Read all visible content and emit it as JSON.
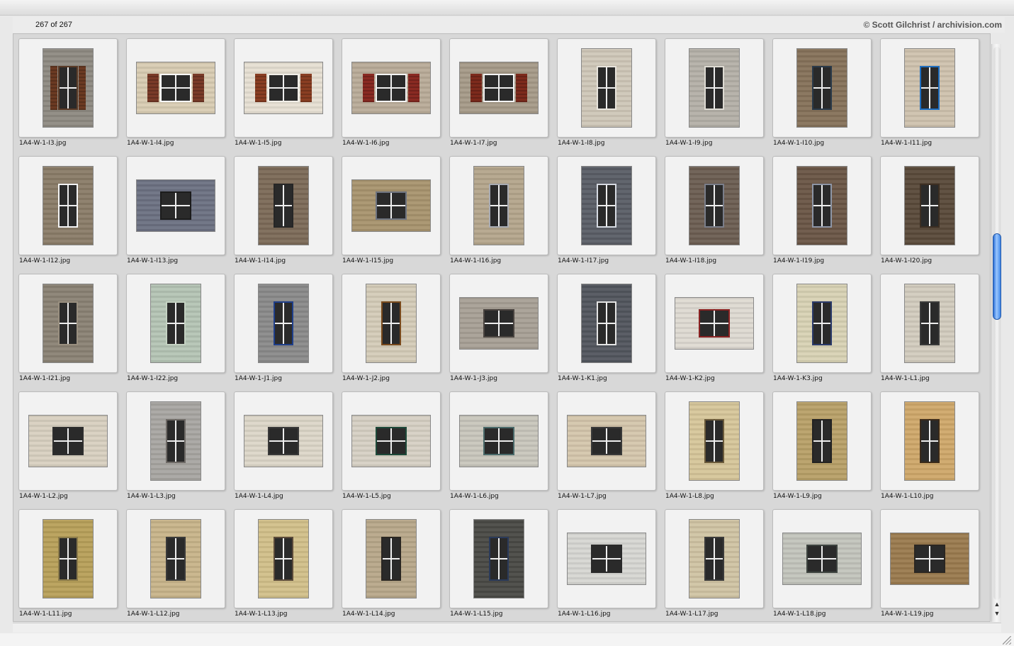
{
  "header": {
    "count": "267 of 267",
    "copyright": "© Scott Gilchrist / archivision.com"
  },
  "scrollbar": {
    "up_glyph": "▲",
    "down_glyph": "▼",
    "position": 0.4
  },
  "thumbnails": [
    {
      "label": "1A4-W-1-I3.jpg",
      "orient": "sq",
      "bg": "#8e8a82",
      "frame": "#5a3a26",
      "shutter": "#6b3a22"
    },
    {
      "label": "1A4-W-1-I4.jpg",
      "orient": "land",
      "bg": "#d8ccb2",
      "frame": "#ffffff",
      "shutter": "#7a3b28"
    },
    {
      "label": "1A4-W-1-I5.jpg",
      "orient": "land",
      "bg": "#e6dfd2",
      "frame": "#f2efe8",
      "shutter": "#8a3e22"
    },
    {
      "label": "1A4-W-1-I6.jpg",
      "orient": "land",
      "bg": "#b9ab98",
      "frame": "#f4f4f4",
      "shutter": "#8a2a22"
    },
    {
      "label": "1A4-W-1-I7.jpg",
      "orient": "land",
      "bg": "#a69a88",
      "frame": "#f4f4f4",
      "shutter": "#7d2a1c"
    },
    {
      "label": "1A4-W-1-I8.jpg",
      "orient": "port",
      "bg": "#cfc7b8",
      "frame": "#e8e4dc",
      "shutter": ""
    },
    {
      "label": "1A4-W-1-I9.jpg",
      "orient": "port",
      "bg": "#b4b0a8",
      "frame": "#dddad2",
      "shutter": ""
    },
    {
      "label": "1A4-W-1-I10.jpg",
      "orient": "port",
      "bg": "#86725a",
      "frame": "#2a3a4a",
      "shutter": ""
    },
    {
      "label": "1A4-W-1-I11.jpg",
      "orient": "port",
      "bg": "#cfc2ae",
      "frame": "#1e6ec0",
      "shutter": ""
    },
    {
      "label": "1A4-W-1-I12.jpg",
      "orient": "sq",
      "bg": "#8a7c68",
      "frame": "#f4f4f4",
      "shutter": ""
    },
    {
      "label": "1A4-W-1-I13.jpg",
      "orient": "land",
      "bg": "#6c7182",
      "frame": "#1c1c1c",
      "shutter": ""
    },
    {
      "label": "1A4-W-1-I14.jpg",
      "orient": "port",
      "bg": "#7c6a58",
      "frame": "#262626",
      "shutter": ""
    },
    {
      "label": "1A4-W-1-I15.jpg",
      "orient": "land",
      "bg": "#a8946e",
      "frame": "#6e7480",
      "shutter": ""
    },
    {
      "label": "1A4-W-1-I16.jpg",
      "orient": "port",
      "bg": "#b4a68c",
      "frame": "#a9acb4",
      "shutter": ""
    },
    {
      "label": "1A4-W-1-I17.jpg",
      "orient": "port",
      "bg": "#5a5e66",
      "frame": "#d6dae2",
      "shutter": ""
    },
    {
      "label": "1A4-W-1-I18.jpg",
      "orient": "port",
      "bg": "#6c5e52",
      "frame": "#7a7e8a",
      "shutter": ""
    },
    {
      "label": "1A4-W-1-I19.jpg",
      "orient": "port",
      "bg": "#6a5646",
      "frame": "#8e96a6",
      "shutter": ""
    },
    {
      "label": "1A4-W-1-I20.jpg",
      "orient": "port",
      "bg": "#5a4a3a",
      "frame": "#3c2e22",
      "shutter": ""
    },
    {
      "label": "1A4-W-1-I21.jpg",
      "orient": "sq",
      "bg": "#8a8274",
      "frame": "#9a9080",
      "shutter": ""
    },
    {
      "label": "1A4-W-1-I22.jpg",
      "orient": "port",
      "bg": "#b4c4b4",
      "frame": "#c4d2c2",
      "shutter": ""
    },
    {
      "label": "1A4-W-1-J1.jpg",
      "orient": "port",
      "bg": "#8a8a8a",
      "frame": "#1e3e8a",
      "shutter": ""
    },
    {
      "label": "1A4-W-1-J2.jpg",
      "orient": "port",
      "bg": "#d4ccb8",
      "frame": "#7a4a1c",
      "shutter": ""
    },
    {
      "label": "1A4-W-1-J3.jpg",
      "orient": "land",
      "bg": "#a8a096",
      "frame": "#4a4440",
      "shutter": ""
    },
    {
      "label": "1A4-W-1-K1.jpg",
      "orient": "port",
      "bg": "#52565e",
      "frame": "#e4e4e4",
      "shutter": ""
    },
    {
      "label": "1A4-W-1-K2.jpg",
      "orient": "land",
      "bg": "#dedad2",
      "frame": "#8a2222",
      "shutter": ""
    },
    {
      "label": "1A4-W-1-K3.jpg",
      "orient": "port",
      "bg": "#d8d2b4",
      "frame": "#2a3a6a",
      "shutter": ""
    },
    {
      "label": "1A4-W-1-L1.jpg",
      "orient": "port",
      "bg": "#d2ccbe",
      "frame": "#3a3a3a",
      "shutter": ""
    },
    {
      "label": "1A4-W-1-L2.jpg",
      "orient": "land",
      "bg": "#d8d0c0",
      "frame": "#2e2e2e",
      "shutter": ""
    },
    {
      "label": "1A4-W-1-L3.jpg",
      "orient": "port",
      "bg": "#a8a6a2",
      "frame": "#6e6a66",
      "shutter": ""
    },
    {
      "label": "1A4-W-1-L4.jpg",
      "orient": "land",
      "bg": "#dcd6c8",
      "frame": "#3a3a3a",
      "shutter": ""
    },
    {
      "label": "1A4-W-1-L5.jpg",
      "orient": "land",
      "bg": "#d6d0c4",
      "frame": "#1e4a3a",
      "shutter": ""
    },
    {
      "label": "1A4-W-1-L6.jpg",
      "orient": "land",
      "bg": "#c8c6bc",
      "frame": "#4a6a6a",
      "shutter": ""
    },
    {
      "label": "1A4-W-1-L7.jpg",
      "orient": "land",
      "bg": "#d4c6ac",
      "frame": "#3a3a3a",
      "shutter": ""
    },
    {
      "label": "1A4-W-1-L8.jpg",
      "orient": "port",
      "bg": "#d6c69a",
      "frame": "#6a5a3a",
      "shutter": ""
    },
    {
      "label": "1A4-W-1-L9.jpg",
      "orient": "port",
      "bg": "#b8a068",
      "frame": "#222222",
      "shutter": ""
    },
    {
      "label": "1A4-W-1-L10.jpg",
      "orient": "port",
      "bg": "#cfa86a",
      "frame": "#3a2a1a",
      "shutter": ""
    },
    {
      "label": "1A4-W-1-L11.jpg",
      "orient": "port",
      "bg": "#b8a05a",
      "frame": "#8a7a4a",
      "shutter": ""
    },
    {
      "label": "1A4-W-1-L12.jpg",
      "orient": "port",
      "bg": "#c8b48a",
      "frame": "#3a3a3a",
      "shutter": ""
    },
    {
      "label": "1A4-W-1-L13.jpg",
      "orient": "port",
      "bg": "#d2c08a",
      "frame": "#5a4a3a",
      "shutter": ""
    },
    {
      "label": "1A4-W-1-L14.jpg",
      "orient": "port",
      "bg": "#b8a88a",
      "frame": "#2a2622",
      "shutter": ""
    },
    {
      "label": "1A4-W-1-L15.jpg",
      "orient": "port",
      "bg": "#4a4a46",
      "frame": "#2a3a5a",
      "shutter": ""
    },
    {
      "label": "1A4-W-1-L16.jpg",
      "orient": "land",
      "bg": "#d6d6d2",
      "frame": "#2a2a2a",
      "shutter": ""
    },
    {
      "label": "1A4-W-1-L17.jpg",
      "orient": "port",
      "bg": "#d0c4a4",
      "frame": "#3a3a3a",
      "shutter": ""
    },
    {
      "label": "1A4-W-1-L18.jpg",
      "orient": "land",
      "bg": "#c2c4bc",
      "frame": "#3e4440",
      "shutter": ""
    },
    {
      "label": "1A4-W-1-L19.jpg",
      "orient": "land",
      "bg": "#9a7a4e",
      "frame": "#2a2622",
      "shutter": ""
    }
  ]
}
